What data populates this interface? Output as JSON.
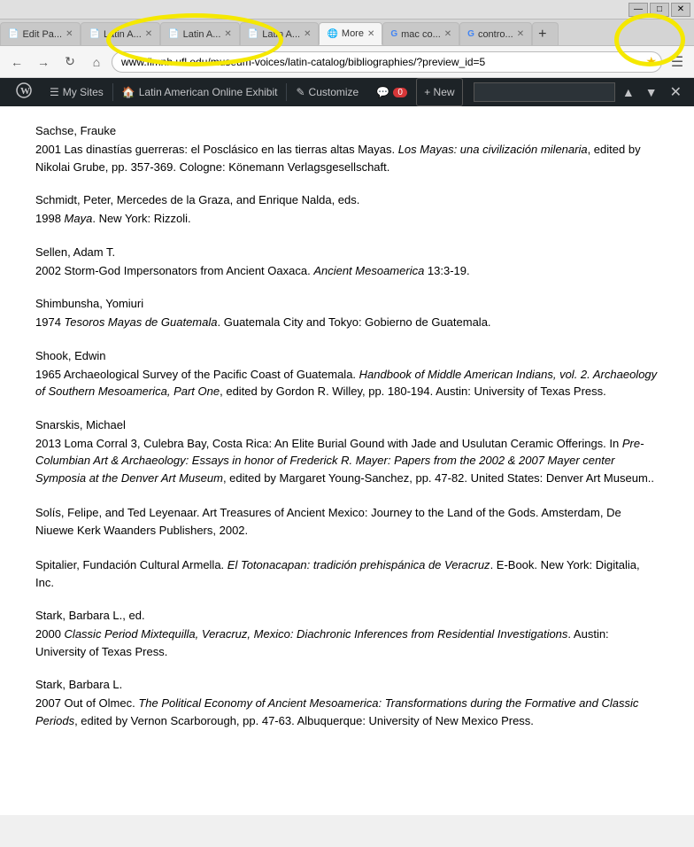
{
  "browser": {
    "title_bar": {
      "minimize": "—",
      "maximize": "□",
      "close": "✕"
    },
    "tabs": [
      {
        "id": "tab1",
        "icon": "📄",
        "label": "Edit Pa...",
        "active": false,
        "closeable": true
      },
      {
        "id": "tab2",
        "icon": "📄",
        "label": "Latin A...",
        "active": false,
        "closeable": true
      },
      {
        "id": "tab3",
        "icon": "📄",
        "label": "Latin A...",
        "active": false,
        "closeable": true
      },
      {
        "id": "tab4",
        "icon": "📄",
        "label": "Latin A...",
        "active": false,
        "closeable": true
      },
      {
        "id": "tab5",
        "icon": "🌐",
        "label": "More",
        "active": true,
        "closeable": true
      },
      {
        "id": "tab6",
        "icon": "G",
        "label": "mac co...",
        "active": false,
        "closeable": true
      },
      {
        "id": "tab7",
        "icon": "G",
        "label": "contro...",
        "active": false,
        "closeable": true
      },
      {
        "id": "tab8",
        "icon": "",
        "label": "",
        "active": false,
        "closeable": false
      }
    ],
    "address": "www.flmnh.ufl.edu/museum-voices/latin-catalog/bibliographies/?preview_id=5",
    "address_placeholder": ""
  },
  "wp_toolbar": {
    "logo": "W",
    "items": [
      {
        "id": "my-sites",
        "label": "My Sites"
      },
      {
        "id": "site-name",
        "label": "Latin American Online Exhibit"
      },
      {
        "id": "customize",
        "label": "Customize"
      },
      {
        "id": "comments",
        "label": "0"
      },
      {
        "id": "new",
        "label": "+ New"
      }
    ],
    "find_input_placeholder": "",
    "find_input_value": ""
  },
  "content": {
    "entries": [
      {
        "id": "sachse",
        "author": "Sachse, Frauke",
        "reference": "2001 Las dinastías guerreras: el Posclásico en las tierras altas Mayas. Los Mayas: una civilización milenaria, edited by Nikolai Grube, pp. 357-369. Cologne: Könemann Verlagsgesellschaft.",
        "italic_parts": [
          "Los Mayas: una civilización milenaria"
        ],
        "highlight": "Los Mayas: una civilización milenaria"
      },
      {
        "id": "schmidt",
        "author": "Schmidt, Peter, Mercedes de la Graza, and Enrique Nalda, eds.",
        "reference": "1998 Maya. New York: Rizzoli.",
        "italic_parts": [
          "Maya"
        ]
      },
      {
        "id": "sellen",
        "author": "Sellen, Adam T.",
        "reference": "2002 Storm-God Impersonators from Ancient Oaxaca. Ancient Mesoamerica 13:3-19.",
        "italic_parts": [
          "Ancient Mesoamerica"
        ]
      },
      {
        "id": "shimbunsha",
        "author": "Shimbunsha, Yomiuri",
        "reference": "1974 Tesoros Mayas de Guatemala. Guatemala City and Tokyo: Gobierno de Guatemala.",
        "italic_parts": [
          "Tesoros Mayas de Guatemala"
        ]
      },
      {
        "id": "shook",
        "author": "Shook, Edwin",
        "reference": "1965 Archaeological Survey of the Pacific Coast of Guatemala. Handbook of Middle American Indians, vol. 2. Archaeology of Southern Mesoamerica, Part One, edited by Gordon R. Willey, pp. 180-194. Austin: University of Texas Press.",
        "italic_parts": [
          "Handbook of Middle American Indians,",
          "Archaeology of Southern Mesoamerica, Part One"
        ]
      },
      {
        "id": "snarskis",
        "author": "Snarskis, Michael",
        "reference": "2013 Loma Corral 3, Culebra Bay, Costa Rica: An Elite Burial Gound with Jade and Usulutan Ceramic Offerings. In Pre-Columbian Art & Archaeology: Essays in honor of Frederick R. Mayer: Papers from the 2002 & 2007 Mayer center Symposia at the Denver Art Museum, edited by Margaret Young-Sanchez, pp. 47-82. United States: Denver Art Museum..",
        "italic_parts": [
          "Pre-Columbian Art & Archaeology: Essays in honor of Frederick R. Mayer: Papers from the 2002 & 2007 Mayer center Symposia at the Denver Art Museum"
        ]
      },
      {
        "id": "solis",
        "author": "",
        "reference": "Solís, Felipe, and Ted Leyenaar. Art Treasures of Ancient Mexico: Journey to the Land of the Gods. Amsterdam, De Niuewe Kerk Waanders Publishers, 2002.",
        "italic_parts": []
      },
      {
        "id": "spitalier",
        "author": "",
        "reference": "Spitalier, Fundación Cultural Armella. El Totonacapan: tradición prehispánica de Veracruz. E-Book. New York: Digitalia, Inc.",
        "italic_parts": [
          "El Totonacapan: tradición prehispánica de Veracruz"
        ]
      },
      {
        "id": "stark1",
        "author": "Stark, Barbara L., ed.",
        "reference": "2000 Classic Period Mixtequilla, Veracruz, Mexico: Diachronic Inferences from Residential Investigations. Austin: University of Texas Press.",
        "italic_parts": [
          "Classic Period Mixtequilla, Veracruz, Mexico: Diachronic Inferences from Residential Investigations"
        ]
      },
      {
        "id": "stark2",
        "author": "Stark, Barbara L.",
        "reference": "2007 Out of Olmec. The Political Economy of Ancient Mesoamerica: Transformations during the Formative and Classic Periods, edited by Vernon Scarborough, pp. 47-63. Albuquerque: University of New Mexico Press.",
        "italic_parts": [
          "The Political Economy of Ancient Mesoamerica: Transformations during the Formative and Classic Periods"
        ]
      }
    ]
  }
}
